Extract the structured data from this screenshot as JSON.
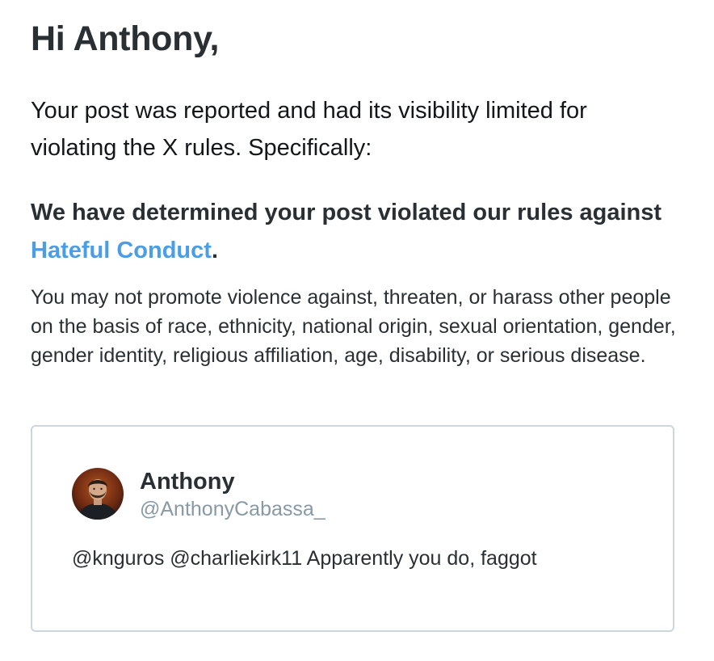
{
  "email": {
    "greeting": "Hi Anthony,",
    "intro": "Your post was reported and had its visibility limited for violating the X rules. Specifically:",
    "determination_prefix": "We have determined your post violated our rules against ",
    "rule_link": "Hateful Conduct",
    "determination_suffix": ".",
    "rule_description": "You may not promote violence against, threaten, or harass other people on the basis of race, ethnicity, national origin, sexual orientation, gender, gender identity, religious affiliation, age, disability, or serious disease."
  },
  "post": {
    "author_name": "Anthony",
    "author_handle": "@AnthonyCabassa_",
    "text": "@knguros @charliekirk11 Apparently you do, faggot",
    "avatar_icon": "profile-photo"
  },
  "colors": {
    "text_primary": "#292f33",
    "text_secondary": "#8899a6",
    "link": "#4a9ee8",
    "card_border": "#ccd6dd",
    "background": "#ffffff"
  }
}
